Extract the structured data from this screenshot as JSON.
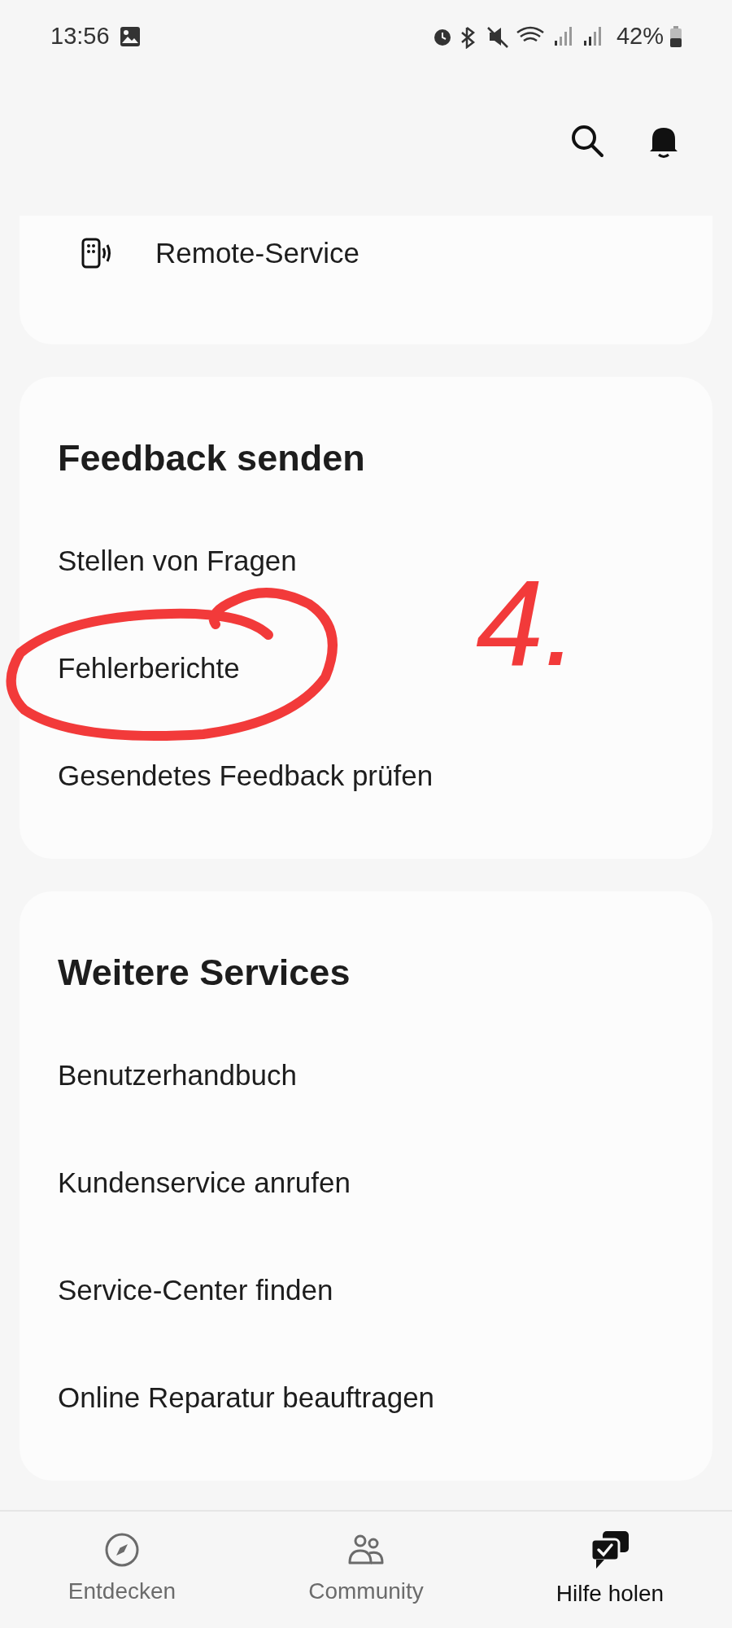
{
  "status_bar": {
    "time": "13:56",
    "battery": "42%"
  },
  "top_card": {
    "items": [
      {
        "label": "Remote-Service"
      }
    ]
  },
  "sections": [
    {
      "title": "Feedback senden",
      "items": [
        {
          "label": "Stellen von Fragen"
        },
        {
          "label": "Fehlerberichte"
        },
        {
          "label": "Gesendetes Feedback prüfen"
        }
      ]
    },
    {
      "title": "Weitere Services",
      "items": [
        {
          "label": "Benutzerhandbuch"
        },
        {
          "label": "Kundenservice anrufen"
        },
        {
          "label": "Service-Center finden"
        },
        {
          "label": "Online Reparatur beauftragen"
        }
      ]
    }
  ],
  "annotation": {
    "label": "4."
  },
  "bottom_nav": [
    {
      "label": "Entdecken",
      "kind": "compass",
      "selected": false
    },
    {
      "label": "Community",
      "kind": "people",
      "selected": false
    },
    {
      "label": "Hilfe holen",
      "kind": "chat",
      "selected": true
    }
  ]
}
